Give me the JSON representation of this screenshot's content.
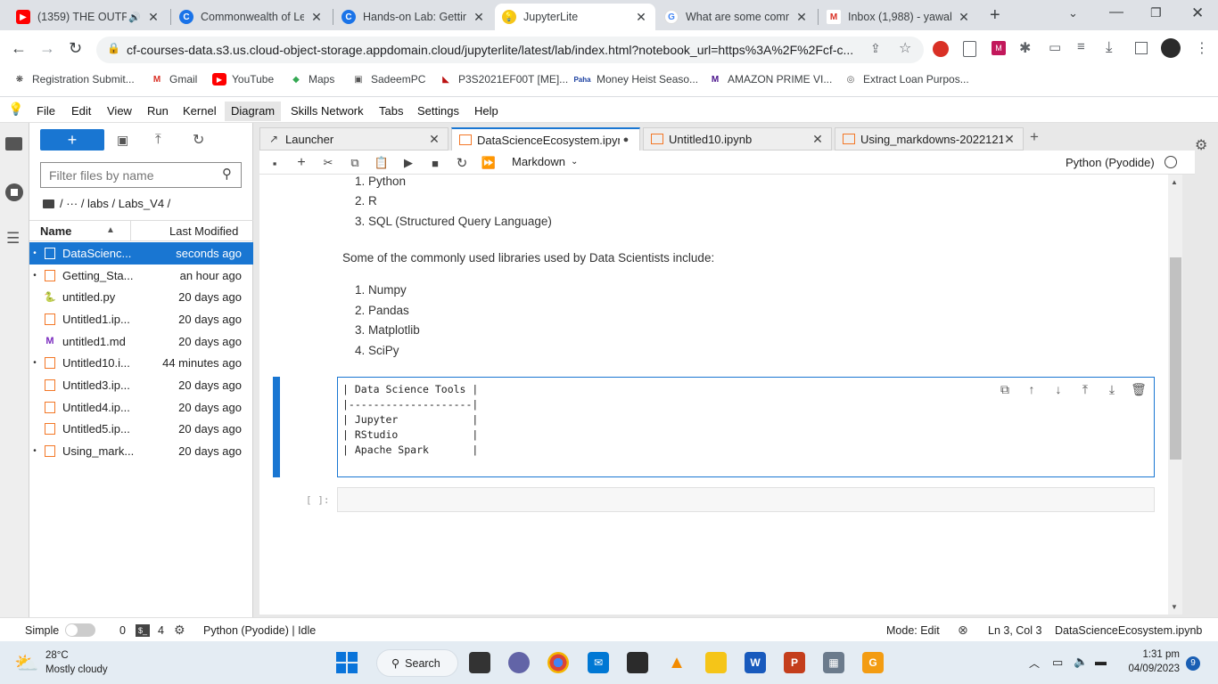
{
  "browser": {
    "tabs": [
      {
        "title": "(1359) THE OUTPU",
        "favicon": "youtube-icon",
        "active": false
      },
      {
        "title": "Commonwealth of Lea",
        "favicon": "coursera-icon",
        "active": false
      },
      {
        "title": "Hands-on Lab: Gettin",
        "favicon": "coursera-icon",
        "active": false
      },
      {
        "title": "JupyterLite",
        "favicon": "jupyterlite-icon",
        "active": true
      },
      {
        "title": "What are some comm",
        "favicon": "google-icon",
        "active": false
      },
      {
        "title": "Inbox (1,988) - yawab",
        "favicon": "gmail-icon",
        "active": false
      }
    ],
    "url": "cf-courses-data.s3.us.cloud-object-storage.appdomain.cloud/jupyterlite/latest/lab/index.html?notebook_url=https%3A%2F%2Fcf-c...",
    "bookmarks": [
      {
        "label": "Registration Submit...",
        "icon": "bookmark-icon"
      },
      {
        "label": "Gmail",
        "icon": "gmail-icon"
      },
      {
        "label": "YouTube",
        "icon": "youtube-icon"
      },
      {
        "label": "Maps",
        "icon": "maps-icon"
      },
      {
        "label": "SadeemPC",
        "icon": "pc-icon"
      },
      {
        "label": "P3S2021EF00T [ME]...",
        "icon": "bookmark-icon"
      },
      {
        "label": "Money Heist Seaso...",
        "icon": "paha-icon"
      },
      {
        "label": "AMAZON PRIME VI...",
        "icon": "amazon-icon"
      },
      {
        "label": "Extract Loan Purpos...",
        "icon": "extract-icon"
      }
    ]
  },
  "menu": [
    "File",
    "Edit",
    "View",
    "Run",
    "Kernel",
    "Diagram",
    "Skills Network",
    "Tabs",
    "Settings",
    "Help"
  ],
  "filebrowser": {
    "filter_placeholder": "Filter files by name",
    "breadcrumb": "/ ··· / labs / Labs_V4 /",
    "col_name": "Name",
    "col_modified": "Last Modified",
    "files": [
      {
        "name": "DataScienc...",
        "modified": "seconds ago",
        "type": "notebook",
        "running": true,
        "selected": true
      },
      {
        "name": "Getting_Sta...",
        "modified": "an hour ago",
        "type": "notebook",
        "running": true,
        "selected": false
      },
      {
        "name": "untitled.py",
        "modified": "20 days ago",
        "type": "python",
        "running": false,
        "selected": false
      },
      {
        "name": "Untitled1.ip...",
        "modified": "20 days ago",
        "type": "notebook",
        "running": false,
        "selected": false
      },
      {
        "name": "untitled1.md",
        "modified": "20 days ago",
        "type": "markdown",
        "running": false,
        "selected": false
      },
      {
        "name": "Untitled10.i...",
        "modified": "44 minutes ago",
        "type": "notebook",
        "running": true,
        "selected": false
      },
      {
        "name": "Untitled3.ip...",
        "modified": "20 days ago",
        "type": "notebook",
        "running": false,
        "selected": false
      },
      {
        "name": "Untitled4.ip...",
        "modified": "20 days ago",
        "type": "notebook",
        "running": false,
        "selected": false
      },
      {
        "name": "Untitled5.ip...",
        "modified": "20 days ago",
        "type": "notebook",
        "running": false,
        "selected": false
      },
      {
        "name": "Using_mark...",
        "modified": "20 days ago",
        "type": "notebook",
        "running": true,
        "selected": false
      }
    ]
  },
  "doctabs": [
    {
      "title": "Launcher",
      "active": false
    },
    {
      "title": "DataScienceEcosystem.ipynb",
      "active": true
    },
    {
      "title": "Untitled10.ipynb",
      "active": false
    },
    {
      "title": "Using_markdowns-20221213",
      "active": false
    }
  ],
  "toolbar": {
    "cell_type": "Markdown",
    "kernel": "Python (Pyodide)"
  },
  "notebook": {
    "languages": [
      "1. Python",
      "2. R",
      "3. SQL (Structured Query Language)"
    ],
    "libraries_intro": "Some of the commonly used libraries used by Data Scientists include:",
    "libraries": [
      "1. Numpy",
      "2. Pandas",
      "3. Matplotlib",
      "4. SciPy"
    ],
    "code_lines": [
      "| Data Science Tools |",
      "|--------------------|",
      "| Jupyter            |",
      "| RStudio            |",
      "| Apache Spark       |"
    ],
    "empty_prompt": "[ ]:"
  },
  "status": {
    "mode_label": "Simple",
    "terminals": "0",
    "kernels": "4",
    "kernel_status": "Python (Pyodide) | Idle",
    "mode": "Mode: Edit",
    "cursor": "Ln 3, Col 3",
    "filename": "DataScienceEcosystem.ipynb"
  },
  "taskbar": {
    "weather_temp": "28°C",
    "weather_desc": "Mostly cloudy",
    "search": "Search",
    "time": "1:31 pm",
    "date": "04/09/2023",
    "notifications": "9"
  },
  "colors": {
    "accent": "#1976d2",
    "youtube": "#ff0000",
    "jupyter": "#f37726"
  }
}
